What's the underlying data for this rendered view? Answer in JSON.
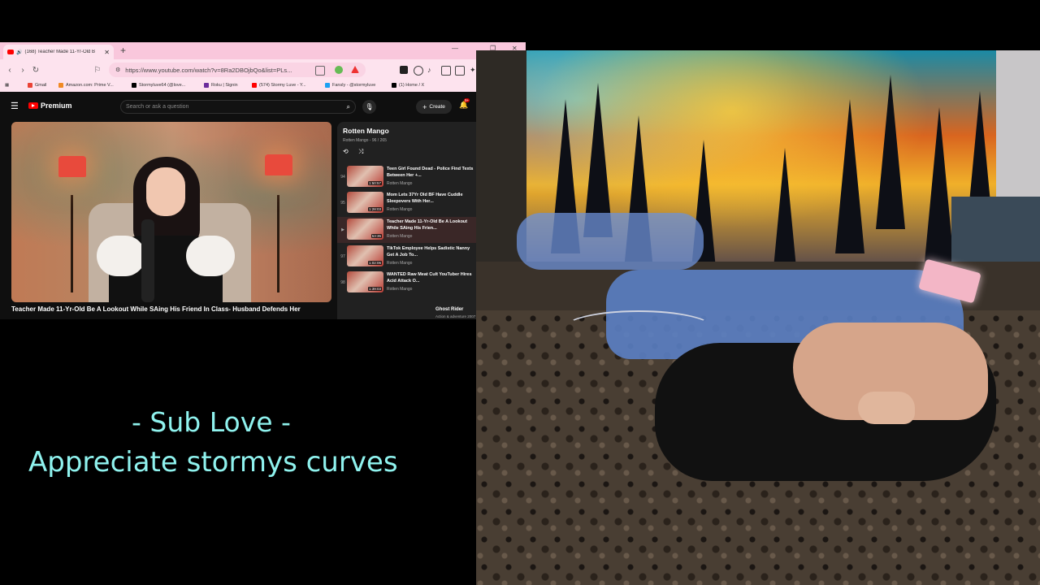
{
  "browser": {
    "tab_title": "(168) Teacher Made 11-Yr-Old B",
    "url": "https://www.youtube.com/watch?v=8Ra2DBOjbQo&list=PLs...",
    "bookmarks": [
      {
        "label": "Gmail",
        "color": "#ea4335"
      },
      {
        "label": "Amazon.com: Prime V...",
        "color": "#f08a24"
      },
      {
        "label": "Stormyluve64 (@love...",
        "color": "#000000"
      },
      {
        "label": "Roku | Signin",
        "color": "#6c2c9c"
      },
      {
        "label": "(574) Stormy Luve - Y...",
        "color": "#ff0000"
      },
      {
        "label": "Fansly - @stormyluve",
        "color": "#1da1f2"
      },
      {
        "label": "(1) Home / X",
        "color": "#000000"
      }
    ]
  },
  "youtube": {
    "brand": "Premium",
    "search_placeholder": "Search or ask a question",
    "create_label": "Create",
    "notification_count": "9+",
    "video_title": "Teacher Made 11-Yr-Old Be A Lookout While SAing His Friend In Class- Husband Defends Her",
    "playlist": {
      "title": "Rotten Mango",
      "subtitle": "Rotten Mango - 96 / 265",
      "items": [
        {
          "index": "94",
          "title": "Teen Girl Found Dead - Police Find Texts Between Her +...",
          "channel": "Rotten Mango",
          "duration": "1:50:57"
        },
        {
          "index": "95",
          "title": "Mom Lets 37Yr Old BF Have Cuddle Sleepovers With Her...",
          "channel": "Rotten Mango",
          "duration": "1:28:03"
        },
        {
          "index": "▶",
          "title": "Teacher Made 11-Yr-Old Be A Lookout While SAing His Frien...",
          "channel": "Rotten Mango",
          "duration": "53:35"
        },
        {
          "index": "97",
          "title": "TikTok Employee Helps Sadistic Nanny Get A Job To...",
          "channel": "Rotten Mango",
          "duration": "1:02:06"
        },
        {
          "index": "98",
          "title": "WANTED Raw Meat Cult YouTuber Hires Acid Attack O...",
          "channel": "Rotten Mango",
          "duration": "1:39:03"
        }
      ]
    },
    "next_up": {
      "title": "Ghost Rider",
      "subtitle": "Action & adventure 2007"
    }
  },
  "overlay": {
    "line1": "- Sub Love -",
    "line2": "Appreciate stormys curves"
  }
}
